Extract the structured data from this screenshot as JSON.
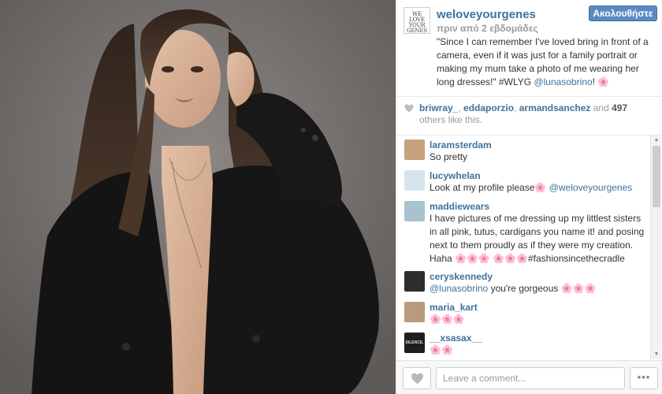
{
  "post": {
    "owner": "weloveyourgenes",
    "avatar_text": "WE LOVE YOUR GENES",
    "time": "πριν από 2 εβδομάδες",
    "follow_label": "Ακολουθήστε",
    "caption_text": "\"Since I can remember I've loved bring in front of a camera, even if it was just for a family portrait or making my mum take a photo of me wearing her long dresses!\" #WLYG ",
    "caption_mention": "@lunasobrino",
    "caption_tail": "! 🌸"
  },
  "likes": {
    "users": [
      "briwray_",
      "eddaporzio",
      "armandsanchez"
    ],
    "sep1": ", ",
    "sep2": ", ",
    "and_text": " and ",
    "count": "497",
    "tail": " others like this."
  },
  "comments": [
    {
      "user": "laramsterdam",
      "text": "So pretty",
      "mention": "",
      "after": "",
      "avatar_color": "#c7a27c"
    },
    {
      "user": "lucywhelan",
      "text": "Look at my profile please🌸 ",
      "mention": "@weloveyourgenes",
      "after": "",
      "avatar_color": "#d6e4ec"
    },
    {
      "user": "maddiewears",
      "text": "I have pictures of me dressing up my littlest sisters in all pink, tutus, cardigans you name it! and posing next to them proudly as if they were my creation. Haha 🌸🌸🌸 🌸🌸🌸#fashionsincethecradle",
      "mention": "",
      "after": "",
      "avatar_color": "#a8c3cf"
    },
    {
      "user": "ceryskennedy",
      "text": "",
      "mention": "@lunasobrino",
      "after": " you're gorgeous 🌸🌸🌸",
      "avatar_color": "#2d2d2d"
    },
    {
      "user": "maria_kart",
      "text": "🌸🌸🌸",
      "mention": "",
      "after": "",
      "avatar_color": "#b89a7e"
    },
    {
      "user": "__xsasax__",
      "text": "🌸🌸",
      "mention": "",
      "after": "",
      "avatar_color": "#1e1e1e",
      "avatar_text": "SILENCE."
    }
  ],
  "footer": {
    "comment_placeholder": "Leave a comment...",
    "more_label": "•••"
  },
  "colors": {
    "link": "#3f729b",
    "follow_button": "#5a8ac1",
    "photo_background": "#6f6a67"
  }
}
